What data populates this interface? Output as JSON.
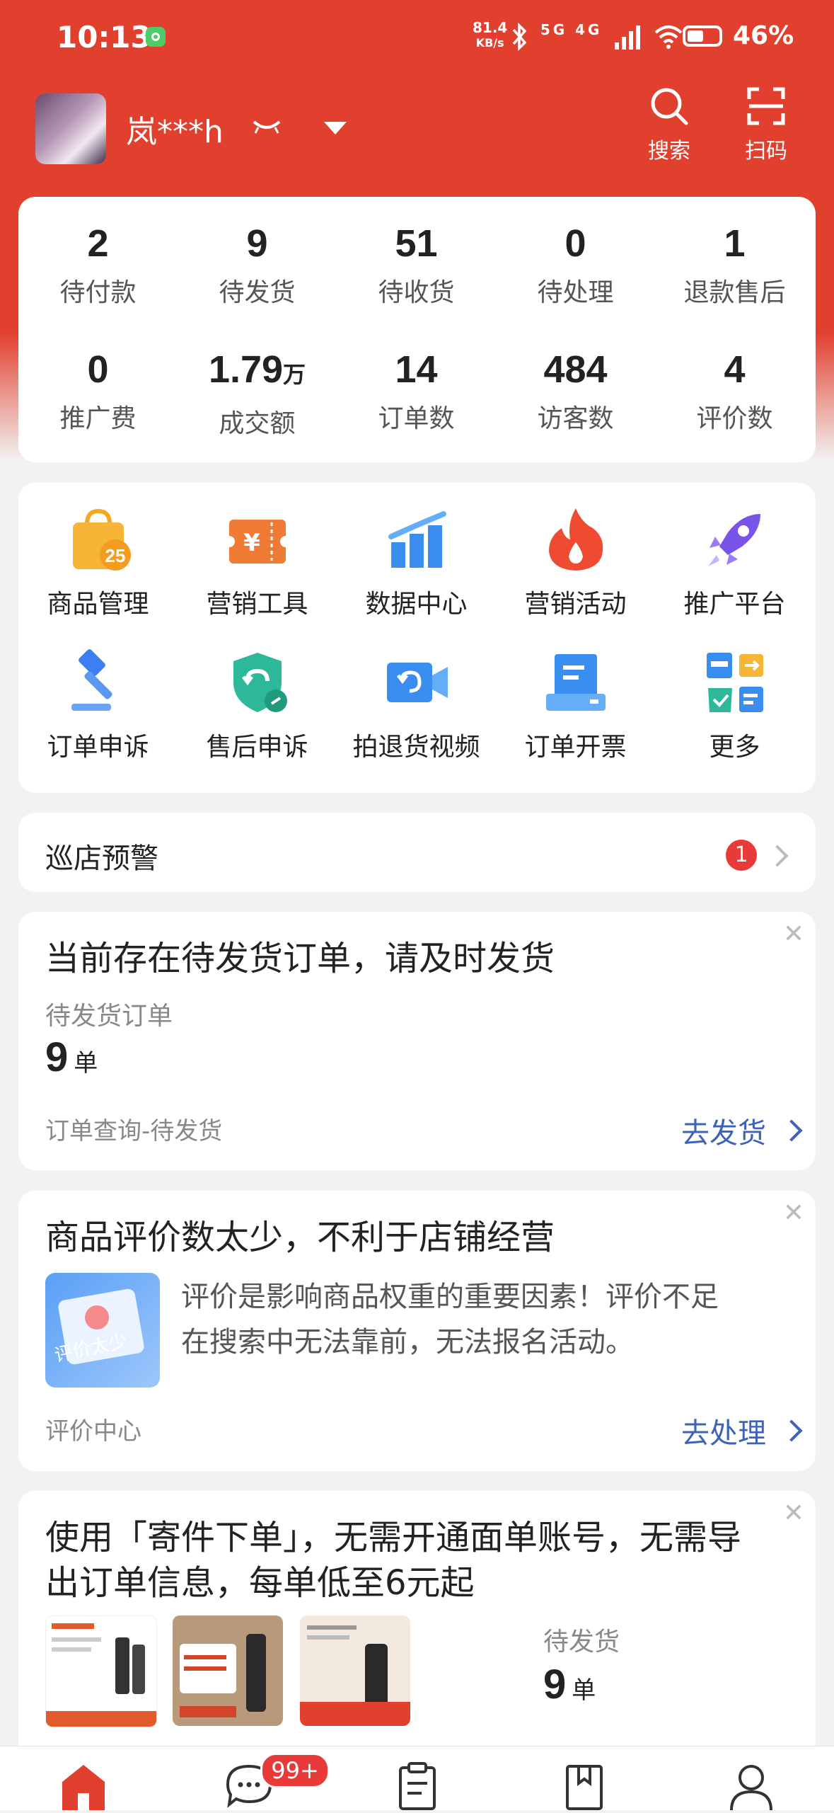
{
  "status_bar": {
    "time": "10:13",
    "net_speed_value": "81.4",
    "net_speed_unit": "KB/s",
    "signals": "5G 4G",
    "battery": "46%"
  },
  "header": {
    "shop_name": "岚***h",
    "search_label": "搜索",
    "scan_label": "扫码"
  },
  "stats": [
    {
      "value": "2",
      "unit": "",
      "label": "待付款"
    },
    {
      "value": "9",
      "unit": "",
      "label": "待发货"
    },
    {
      "value": "51",
      "unit": "",
      "label": "待收货"
    },
    {
      "value": "0",
      "unit": "",
      "label": "待处理"
    },
    {
      "value": "1",
      "unit": "",
      "label": "退款售后"
    },
    {
      "value": "0",
      "unit": "",
      "label": "推广费"
    },
    {
      "value": "1.79",
      "unit": "万",
      "label": "成交额"
    },
    {
      "value": "14",
      "unit": "",
      "label": "订单数"
    },
    {
      "value": "484",
      "unit": "",
      "label": "访客数"
    },
    {
      "value": "4",
      "unit": "",
      "label": "评价数"
    }
  ],
  "tools": [
    {
      "label": "商品管理",
      "icon": "shopping-bag-icon",
      "badge": "25"
    },
    {
      "label": "营销工具",
      "icon": "coupon-icon"
    },
    {
      "label": "数据中心",
      "icon": "bar-chart-icon"
    },
    {
      "label": "营销活动",
      "icon": "flame-icon"
    },
    {
      "label": "推广平台",
      "icon": "rocket-icon"
    },
    {
      "label": "订单申诉",
      "icon": "gavel-icon"
    },
    {
      "label": "售后申诉",
      "icon": "shield-return-icon"
    },
    {
      "label": "拍退货视频",
      "icon": "video-camera-icon"
    },
    {
      "label": "订单开票",
      "icon": "invoice-printer-icon"
    },
    {
      "label": "更多",
      "icon": "more-apps-icon"
    }
  ],
  "patrol": {
    "title": "巡店预警",
    "badge": "1"
  },
  "ship_card": {
    "title": "当前存在待发货订单，请及时发货",
    "label": "待发货订单",
    "count": "9",
    "unit": "单",
    "footer": "订单查询-待发货",
    "action": "去发货"
  },
  "review_card": {
    "title": "商品评价数太少，不利于店铺经营",
    "image_text": "评价太少",
    "text_line1": "评价是影响商品权重的重要因素！评价不足",
    "text_line2": "在搜索中无法靠前，无法报名活动。",
    "footer": "评价中心",
    "action": "去处理"
  },
  "shipping_promo": {
    "title_line1": "使用「寄件下单」，无需开通面单账号，无需导",
    "title_line2": "出订单信息，每单低至6元起",
    "label": "待发货",
    "count": "9",
    "unit": "单"
  },
  "bottom_nav": {
    "messages_badge": "99+"
  },
  "colors": {
    "brand_red": "#e2402f",
    "link_blue": "#3c63b8",
    "badge_red": "#e93a3a"
  }
}
